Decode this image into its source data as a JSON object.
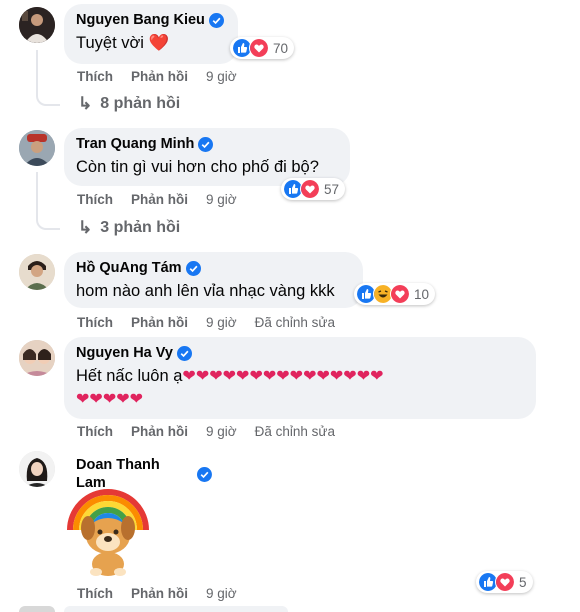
{
  "comments": [
    {
      "name": "Nguyen Bang Kieu",
      "text": "Tuyệt vời ❤️",
      "actions": {
        "like": "Thích",
        "reply": "Phản hồi",
        "time": "9 giờ"
      },
      "reaction_count": "70",
      "replies_label": "8 phản hồi"
    },
    {
      "name": "Tran Quang Minh",
      "text": "Còn tin gì vui hơn cho phố đi bộ?",
      "actions": {
        "like": "Thích",
        "reply": "Phản hồi",
        "time": "9 giờ"
      },
      "reaction_count": "57",
      "replies_label": "3 phản hồi"
    },
    {
      "name": "Hồ QuAng Tám",
      "text": "hom nào anh lên vỉa nhạc vàng kkk",
      "actions": {
        "like": "Thích",
        "reply": "Phản hồi",
        "time": "9 giờ",
        "edited": "Đã chỉnh sửa"
      },
      "reaction_count": "10"
    },
    {
      "name": "Nguyen Ha Vy",
      "text_prefix": "Hết nấc luôn ạ",
      "hearts_line1": "❤❤❤❤❤❤❤❤❤❤❤❤❤❤❤",
      "hearts_line2": "❤❤❤❤❤",
      "actions": {
        "like": "Thích",
        "reply": "Phản hồi",
        "time": "9 giờ",
        "edited": "Đã chỉnh sửa"
      }
    },
    {
      "name": "Doan Thanh Lam",
      "sticker": "rainbow-dog-sticker",
      "actions": {
        "like": "Thích",
        "reply": "Phản hồi",
        "time": "9 giờ"
      },
      "reaction_count": "5"
    }
  ],
  "colors": {
    "bubble": "#f0f2f5",
    "verified": "#1877f2",
    "like": "#1877f2",
    "love": "#f33e58",
    "muted": "#65676b"
  }
}
